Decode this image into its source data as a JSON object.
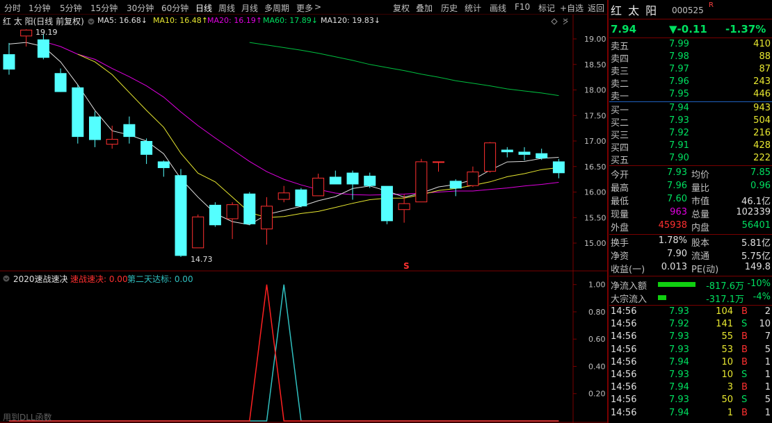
{
  "periods": [
    "分时",
    "1分钟",
    "5分钟",
    "15分钟",
    "30分钟",
    "60分钟",
    "日线",
    "周线",
    "月线",
    "多周期",
    "更多"
  ],
  "active_period": "日线",
  "more_arrow": ">",
  "toolbar": [
    "复权",
    "叠加",
    "历史",
    "统计",
    "画线",
    "F10",
    "标记",
    "+自选",
    "返回"
  ],
  "main_chart": {
    "title": "红 太 阳(日线 前复权)",
    "legend": [
      {
        "label": "MA5: 16.68↓",
        "color": "#e0e0e0"
      },
      {
        "label": "MA10: 16.48↑",
        "color": "#e8e830"
      },
      {
        "label": "MA20: 16.19↑",
        "color": "#e000e0"
      },
      {
        "label": "MA60: 17.89↓",
        "color": "#00e060"
      },
      {
        "label": "MA120: 19.83↓",
        "color": "#e0e0e0"
      }
    ],
    "y_ticks": [
      "19.00",
      "18.50",
      "18.00",
      "17.50",
      "17.00",
      "16.50",
      "16.00",
      "15.50",
      "15.00"
    ],
    "high_label": "19.19",
    "low_label": "14.73",
    "s_marker": "S"
  },
  "sub_chart": {
    "title": "2020速战速决",
    "items": [
      {
        "label": "速战速决: 0.00",
        "color": "#ff3030"
      },
      {
        "label": "第二天达标: 0.00",
        "color": "#30c0c0"
      }
    ],
    "y_ticks": [
      "1.00",
      "0.80",
      "0.60",
      "0.40",
      "0.20"
    ],
    "watermark": "用到DLL函数"
  },
  "chart_data": {
    "type": "candlestick",
    "candles": [
      {
        "o": 18.7,
        "c": 18.4,
        "h": 18.92,
        "l": 18.3
      },
      {
        "o": 19.05,
        "c": 19.18,
        "h": 19.19,
        "l": 18.85
      },
      {
        "o": 18.99,
        "c": 18.63,
        "h": 19.1,
        "l": 18.6
      },
      {
        "o": 18.33,
        "c": 17.96,
        "h": 18.42,
        "l": 18.0
      },
      {
        "o": 18.05,
        "c": 17.08,
        "h": 18.1,
        "l": 16.95
      },
      {
        "o": 17.48,
        "c": 17.02,
        "h": 17.58,
        "l": 16.88
      },
      {
        "o": 16.93,
        "c": 17.04,
        "h": 17.3,
        "l": 16.85
      },
      {
        "o": 17.33,
        "c": 17.08,
        "h": 17.48,
        "l": 16.95
      },
      {
        "o": 17.0,
        "c": 16.73,
        "h": 17.05,
        "l": 16.55
      },
      {
        "o": 16.6,
        "c": 16.47,
        "h": 16.62,
        "l": 16.3
      },
      {
        "o": 16.33,
        "c": 14.75,
        "h": 16.45,
        "l": 14.73
      },
      {
        "o": 14.9,
        "c": 15.52,
        "h": 15.56,
        "l": 14.9
      },
      {
        "o": 15.75,
        "c": 15.35,
        "h": 15.8,
        "l": 15.32
      },
      {
        "o": 15.47,
        "c": 15.76,
        "h": 15.8,
        "l": 15.08
      },
      {
        "o": 15.97,
        "c": 15.37,
        "h": 16.0,
        "l": 15.35
      },
      {
        "o": 15.27,
        "c": 15.73,
        "h": 15.9,
        "l": 14.97
      },
      {
        "o": 15.85,
        "c": 15.99,
        "h": 16.12,
        "l": 15.8
      },
      {
        "o": 16.05,
        "c": 15.72,
        "h": 16.08,
        "l": 15.7
      },
      {
        "o": 15.92,
        "c": 16.28,
        "h": 16.36,
        "l": 15.92
      },
      {
        "o": 16.3,
        "c": 16.15,
        "h": 16.42,
        "l": 16.15
      },
      {
        "o": 16.38,
        "c": 16.15,
        "h": 16.42,
        "l": 15.85
      },
      {
        "o": 16.32,
        "c": 16.12,
        "h": 16.38,
        "l": 16.08
      },
      {
        "o": 16.12,
        "c": 15.43,
        "h": 16.12,
        "l": 15.37
      },
      {
        "o": 15.65,
        "c": 15.78,
        "h": 15.95,
        "l": 15.4
      },
      {
        "o": 15.8,
        "c": 16.6,
        "h": 16.65,
        "l": 15.8
      },
      {
        "o": 16.6,
        "c": 16.6,
        "h": 16.6,
        "l": 16.4
      },
      {
        "o": 16.22,
        "c": 16.07,
        "h": 16.25,
        "l": 15.92
      },
      {
        "o": 16.12,
        "c": 16.4,
        "h": 16.5,
        "l": 16.1
      },
      {
        "o": 16.4,
        "c": 16.97,
        "h": 16.98,
        "l": 16.38
      },
      {
        "o": 16.83,
        "c": 16.78,
        "h": 16.88,
        "l": 16.68
      },
      {
        "o": 16.79,
        "c": 16.73,
        "h": 16.88,
        "l": 16.62
      },
      {
        "o": 16.76,
        "c": 16.66,
        "h": 16.85,
        "l": 16.63
      },
      {
        "o": 16.6,
        "c": 16.37,
        "h": 16.65,
        "l": 16.27
      }
    ],
    "ma5": [
      18.9,
      18.93,
      18.85,
      18.55,
      18.1,
      17.6,
      17.2,
      17.12,
      17.0,
      16.75,
      16.26,
      15.9,
      15.58,
      15.42,
      15.36,
      15.56,
      15.64,
      15.72,
      15.83,
      15.91,
      16.07,
      16.12,
      16.02,
      15.9,
      15.98,
      16.1,
      16.15,
      16.24,
      16.43,
      16.59,
      16.6,
      16.66,
      16.68
    ],
    "ma10": [
      null,
      null,
      null,
      null,
      18.7,
      18.55,
      18.3,
      17.95,
      17.6,
      17.27,
      16.76,
      16.37,
      16.2,
      15.9,
      15.6,
      15.5,
      15.52,
      15.58,
      15.62,
      15.7,
      15.78,
      15.85,
      15.88,
      15.88,
      15.95,
      16.03,
      16.07,
      16.13,
      16.2,
      16.3,
      16.36,
      16.44,
      16.48
    ],
    "ma20": [
      null,
      null,
      18.95,
      18.85,
      18.7,
      18.6,
      18.42,
      18.26,
      18.08,
      17.86,
      17.57,
      17.3,
      17.06,
      16.83,
      16.6,
      16.4,
      16.25,
      16.14,
      16.05,
      15.98,
      15.95,
      15.94,
      15.95,
      15.96,
      15.98,
      16.0,
      16.02,
      16.02,
      16.05,
      16.08,
      16.12,
      16.15,
      16.19
    ],
    "ma60": [
      null,
      null,
      null,
      null,
      null,
      null,
      null,
      null,
      null,
      null,
      null,
      null,
      null,
      null,
      18.93,
      18.88,
      18.83,
      18.78,
      18.72,
      18.65,
      18.58,
      18.5,
      18.44,
      18.38,
      18.31,
      18.25,
      18.18,
      18.13,
      18.08,
      18.02,
      17.98,
      17.94,
      17.89
    ],
    "ylim": [
      14.55,
      19.35
    ],
    "indicator_zs": [
      0,
      0,
      0,
      0,
      0,
      0,
      0,
      0,
      0,
      0,
      0,
      0,
      0,
      0,
      0,
      1,
      0,
      0,
      0,
      0,
      0,
      0,
      0,
      0,
      0,
      0,
      0,
      0,
      0,
      0,
      0,
      0,
      0
    ],
    "indicator_dt": [
      0,
      0,
      0,
      0,
      0,
      0,
      0,
      0,
      0,
      0,
      0,
      0,
      0,
      0,
      0,
      0,
      1,
      0,
      0,
      0,
      0,
      0,
      0,
      0,
      0,
      0,
      0,
      0,
      0,
      0,
      0,
      0,
      0
    ],
    "indicator_ylim": [
      0,
      1.08
    ]
  },
  "quote": {
    "name": "红 太 阳",
    "code": "000525",
    "flag": "R",
    "price": "7.94",
    "change": "▼-0.11",
    "pct": "-1.37%",
    "asks": [
      {
        "label": "卖五",
        "price": "7.99",
        "vol": "410"
      },
      {
        "label": "卖四",
        "price": "7.98",
        "vol": "88"
      },
      {
        "label": "卖三",
        "price": "7.97",
        "vol": "87"
      },
      {
        "label": "卖二",
        "price": "7.96",
        "vol": "243"
      },
      {
        "label": "卖一",
        "price": "7.95",
        "vol": "446"
      }
    ],
    "bids": [
      {
        "label": "买一",
        "price": "7.94",
        "vol": "943"
      },
      {
        "label": "买二",
        "price": "7.93",
        "vol": "504"
      },
      {
        "label": "买三",
        "price": "7.92",
        "vol": "216"
      },
      {
        "label": "买四",
        "price": "7.91",
        "vol": "428"
      },
      {
        "label": "买五",
        "price": "7.90",
        "vol": "222"
      }
    ],
    "stats1": [
      {
        "l1": "今开",
        "v1": "7.93",
        "c1": "g",
        "l2": "均价",
        "v2": "7.85",
        "c2": "g"
      },
      {
        "l1": "最高",
        "v1": "7.96",
        "c1": "g",
        "l2": "量比",
        "v2": "0.96",
        "c2": "g"
      },
      {
        "l1": "最低",
        "v1": "7.60",
        "c1": "g",
        "l2": "市值",
        "v2": "46.1亿",
        "c2": "w"
      },
      {
        "l1": "现量",
        "v1": "963",
        "c1": "m",
        "l2": "总量",
        "v2": "102339",
        "c2": "w"
      },
      {
        "l1": "外盘",
        "v1": "45938",
        "c1": "r",
        "l2": "内盘",
        "v2": "56401",
        "c2": "g"
      }
    ],
    "stats2": [
      {
        "l1": "换手",
        "v1": "1.78%",
        "l2": "股本",
        "v2": "5.81亿"
      },
      {
        "l1": "净资",
        "v1": "7.90",
        "l2": "流通",
        "v2": "5.75亿"
      },
      {
        "l1": "收益(一)",
        "v1": "0.013",
        "l2": "PE(动)",
        "v2": "149.8"
      }
    ],
    "flows": [
      {
        "label": "净流入额",
        "value": "-817.6万",
        "pct": "-10%",
        "bar": 0.52
      },
      {
        "label": "大宗流入",
        "value": "-317.1万",
        "pct": "-4%",
        "bar": 0.12
      }
    ],
    "ticks": [
      {
        "t": "14:56",
        "p": "7.93",
        "v": "104",
        "d": "B",
        "n": "2",
        "vc": "y"
      },
      {
        "t": "14:56",
        "p": "7.92",
        "v": "141",
        "d": "S",
        "n": "10",
        "vc": "y"
      },
      {
        "t": "14:56",
        "p": "7.93",
        "v": "55",
        "d": "B",
        "n": "7",
        "vc": "y"
      },
      {
        "t": "14:56",
        "p": "7.93",
        "v": "53",
        "d": "B",
        "n": "5",
        "vc": "y"
      },
      {
        "t": "14:56",
        "p": "7.94",
        "v": "10",
        "d": "B",
        "n": "1",
        "vc": "y"
      },
      {
        "t": "14:56",
        "p": "7.93",
        "v": "10",
        "d": "S",
        "n": "1",
        "vc": "y"
      },
      {
        "t": "14:56",
        "p": "7.94",
        "v": "3",
        "d": "B",
        "n": "1",
        "vc": "y"
      },
      {
        "t": "14:56",
        "p": "7.93",
        "v": "50",
        "d": "S",
        "n": "5",
        "vc": "y"
      },
      {
        "t": "14:56",
        "p": "7.94",
        "v": "1",
        "d": "B",
        "n": "1",
        "vc": "y"
      }
    ]
  }
}
